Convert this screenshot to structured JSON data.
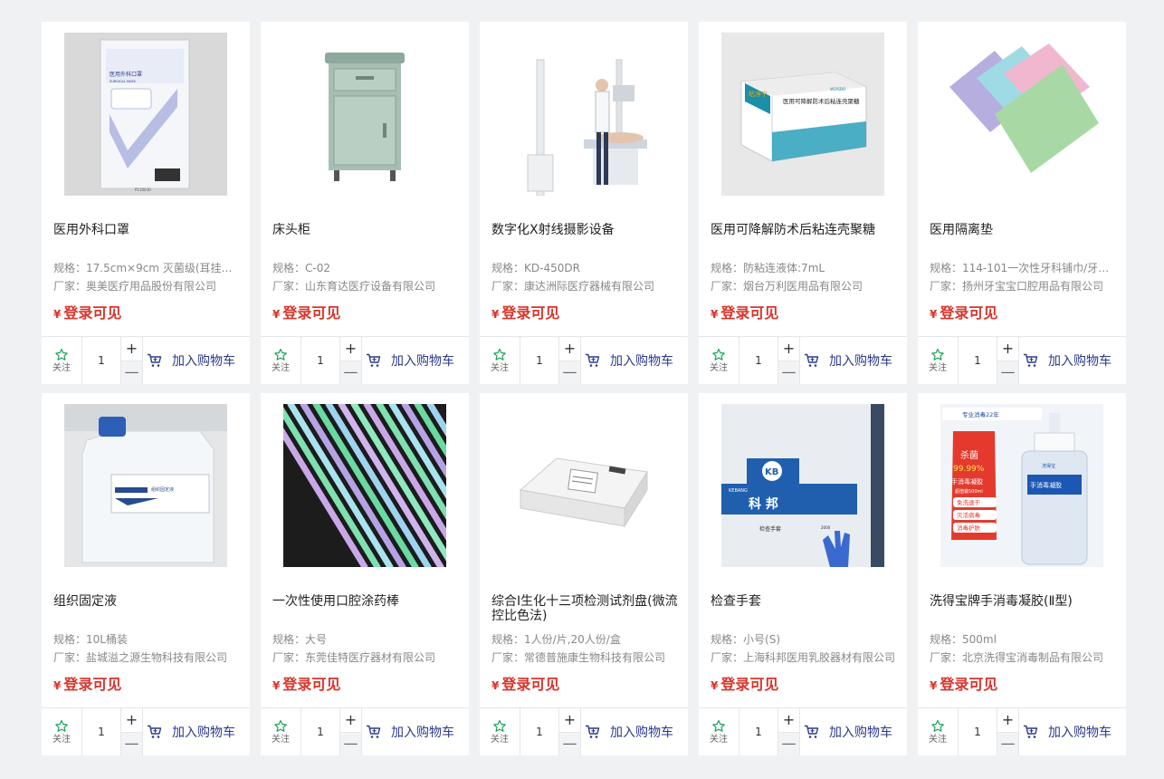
{
  "labels": {
    "spec_prefix": "规格：",
    "maker_prefix": "厂家：",
    "currency": "¥",
    "follow": "关注",
    "add_to_cart": "加入购物车",
    "plus": "+",
    "minus": "—"
  },
  "colors": {
    "price": "#d9342b",
    "cart_text": "#2b3a8c",
    "follow_icon": "#19a35b",
    "background": "#f0f1f3"
  },
  "products": [
    {
      "name": "医用外科口罩",
      "spec": "17.5cm×9cm 灭菌级(耳挂式 ...",
      "maker": "奥美医疗用品股份有限公司",
      "price": "登录可见",
      "qty": "1",
      "icon": "surgical-mask-package-image"
    },
    {
      "name": "床头柜",
      "spec": "C-02",
      "maker": "山东育达医疗设备有限公司",
      "price": "登录可见",
      "qty": "1",
      "icon": "bedside-cabinet-image"
    },
    {
      "name": "数字化X射线摄影设备",
      "spec": "KD-450DR",
      "maker": "康达洲际医疗器械有限公司",
      "price": "登录可见",
      "qty": "1",
      "icon": "xray-machine-image"
    },
    {
      "name": "医用可降解防术后粘连壳聚糖",
      "spec": "防粘连液体:7mL",
      "maker": "烟台万利医用品有限公司",
      "price": "登录可见",
      "qty": "1",
      "icon": "chitosan-box-image"
    },
    {
      "name": "医用隔离垫",
      "spec": "114-101一次性牙科铺巾/牙科...",
      "maker": "扬州牙宝宝口腔用品有限公司",
      "price": "登录可见",
      "qty": "1",
      "icon": "isolation-pad-image"
    },
    {
      "name": "组织固定液",
      "spec": "10L桶装",
      "maker": "盐城溢之源生物科技有限公司",
      "price": "登录可见",
      "qty": "1",
      "icon": "fixative-jug-image"
    },
    {
      "name": "一次性使用口腔涂药棒",
      "spec": "大号",
      "maker": "东莞佳特医疗器材有限公司",
      "price": "登录可见",
      "qty": "1",
      "icon": "applicator-sticks-image"
    },
    {
      "name": "综合I生化十三项检测试剂盘(微流控比色法)",
      "spec": "1人份/片,20人份/盒",
      "maker": "常德普施康生物科技有限公司",
      "price": "登录可见",
      "qty": "1",
      "icon": "reagent-box-image"
    },
    {
      "name": "检查手套",
      "spec": "小号(S)",
      "maker": "上海科邦医用乳胶器材有限公司",
      "price": "登录可见",
      "qty": "1",
      "icon": "gloves-box-image"
    },
    {
      "name": "洗得宝牌手消毒凝胶(Ⅱ型)",
      "spec": "500ml",
      "maker": "北京洗得宝消毒制品有限公司",
      "price": "登录可见",
      "qty": "1",
      "icon": "hand-sanitizer-image"
    }
  ],
  "image_text": {
    "mask": {
      "title": "医用外科口罩",
      "sub": "SURGICAL MASK",
      "code": "P110030"
    },
    "chitosan": {
      "brand": "粘净宁",
      "title": "医用可降解防术后粘连壳聚糖",
      "logo": "WOSBO"
    },
    "jug": {
      "label": "组织固定液"
    },
    "gloves": {
      "brand": "KB",
      "brand_name": "KEBANG",
      "cn": "科 邦",
      "title": "检查手套",
      "count": "2000"
    },
    "sanitizer": {
      "years": "专业消毒22年",
      "kill": "杀菌",
      "rate": "99.99%",
      "title": "手消毒凝胶",
      "vol": "超值装500ml",
      "f1": "免洗速干",
      "f2": "灭活病毒",
      "f3": "消毒护肤",
      "bottle": "手消毒凝胶",
      "brand": "洗得宝"
    }
  }
}
